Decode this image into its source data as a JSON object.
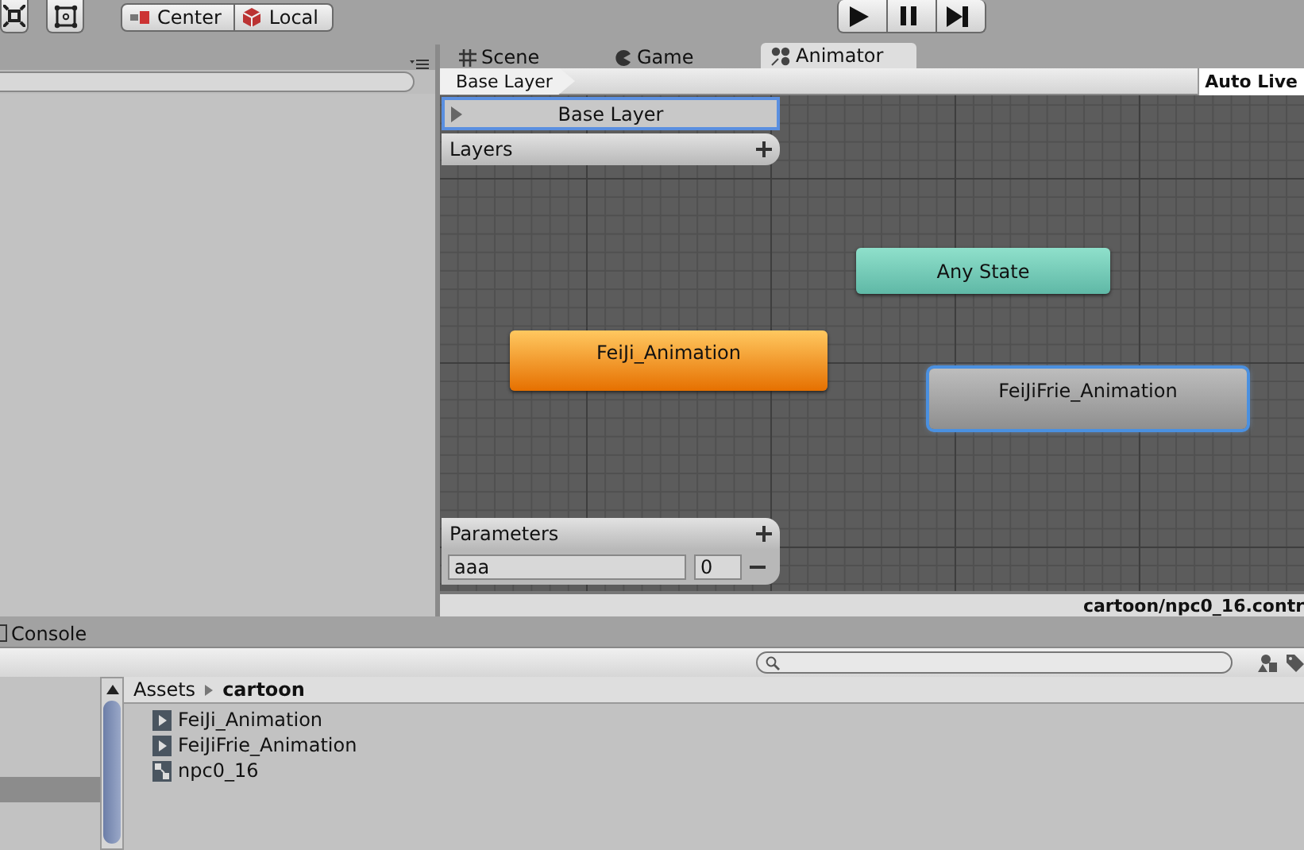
{
  "toolbar": {
    "pivot_buttons": [
      {
        "label": "Center",
        "kind": "pivot"
      },
      {
        "label": "Local",
        "kind": "space"
      }
    ]
  },
  "tabs": [
    {
      "label": "Scene",
      "kind": "scene",
      "selected": false
    },
    {
      "label": "Game",
      "kind": "game",
      "selected": false
    },
    {
      "label": "Animator",
      "kind": "animator",
      "selected": true
    }
  ],
  "animator": {
    "breadcrumb": "Base Layer",
    "auto_live": "Auto Live",
    "layers": {
      "title": "Layers",
      "items": [
        {
          "name": "Base Layer",
          "selected": true
        }
      ]
    },
    "parameters": {
      "title": "Parameters",
      "items": [
        {
          "name": "aaa",
          "value": "0"
        }
      ]
    },
    "states": [
      {
        "name": "Any State",
        "kind": "any",
        "selected": false
      },
      {
        "name": "FeiJi_Animation",
        "kind": "default",
        "selected": false
      },
      {
        "name": "FeiJiFrie_Animation",
        "kind": "normal",
        "selected": true
      }
    ],
    "status_path": "cartoon/npc0_16.contr"
  },
  "console": {
    "tab": "Console"
  },
  "project": {
    "breadcrumb": [
      "Assets",
      "cartoon"
    ],
    "assets": [
      {
        "name": "FeiJi_Animation",
        "kind": "animation"
      },
      {
        "name": "FeiJiFrie_Animation",
        "kind": "animation"
      },
      {
        "name": "npc0_16",
        "kind": "controller"
      }
    ]
  }
}
